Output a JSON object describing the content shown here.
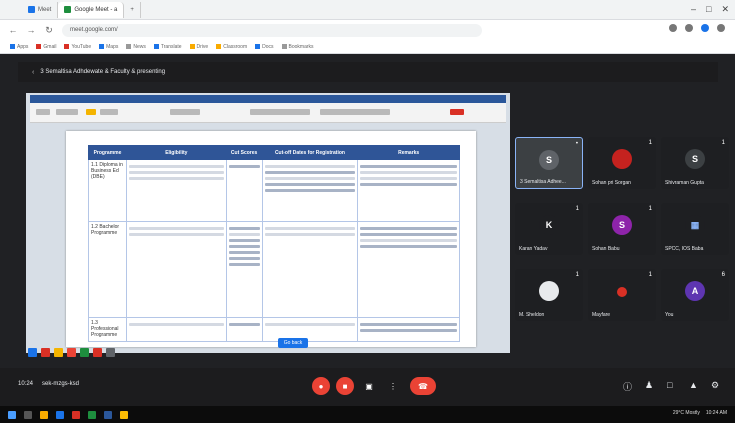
{
  "browser": {
    "tabs": [
      {
        "label": "Meet"
      },
      {
        "label": "Google Meet - a"
      },
      {
        "label": ""
      }
    ],
    "url": "meet.google.com/",
    "bookmarks": [
      "Apps",
      "Gmail",
      "YouTube",
      "Maps",
      "News",
      "Translate",
      "Drive",
      "Classroom",
      "Docs",
      "Bookmarks"
    ]
  },
  "meeting": {
    "title": "3 Semaltisa Adhdewate & Faculty & presenting",
    "time": "10:24",
    "code": "sek-mzgs-ksd"
  },
  "document": {
    "table_headers": [
      "Programme",
      "Eligibility",
      "Cut Scores",
      "Cut-off Dates for Registration",
      "Remarks"
    ],
    "rows": [
      {
        "programme": "1.1 Diploma in Business Ed (DBE)"
      },
      {
        "programme": "1.2 Bachelor Programme"
      },
      {
        "programme": "1.3 Professional Programme"
      }
    ],
    "present_button": "Go back"
  },
  "participants": [
    {
      "initial": "S",
      "name": "3 Semaltisa Adhee...",
      "color": "#3c4043",
      "mic": "•"
    },
    {
      "initial": "",
      "name": "Sohan pri Sorgan",
      "color": "#3c4043",
      "mic": "1"
    },
    {
      "initial": "S",
      "name": "Shivraman Gupta",
      "color": "#3c4043",
      "mic": "1"
    },
    {
      "initial": "K",
      "name": "Karan Yadav",
      "color": "#3c4043",
      "mic": "1"
    },
    {
      "initial": "S",
      "name": "Sohan Babu",
      "color": "#8e24aa",
      "mic": "1"
    },
    {
      "initial": "",
      "name": "SPCC, IOS Baba",
      "color": "#3c4043",
      "mic": ""
    },
    {
      "initial": "",
      "name": "M. Sheldon",
      "color": "#3c4043",
      "mic": "1"
    },
    {
      "initial": "",
      "name": "Mayfare",
      "color": "#3c4043",
      "mic": "1"
    },
    {
      "initial": "A",
      "name": "You",
      "color": "#5e35b1",
      "mic": "6"
    }
  ],
  "tray": {
    "weather": "29°C Mostly",
    "clock": "10:24 AM"
  }
}
